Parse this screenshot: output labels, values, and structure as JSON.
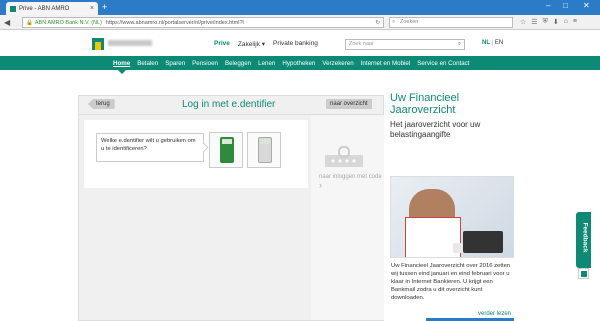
{
  "browser": {
    "tab_title": "Prive - ABN AMRO",
    "new_tab": "+",
    "window_controls": [
      "–",
      "□",
      "✕"
    ],
    "url_org": "ABN AMRO Bank N.V. (NL)",
    "url": "https://www.abnamro.nl/portalserver/nl/prive/index.html?l",
    "search_placeholder": "Zoeken"
  },
  "site": {
    "top_nav": [
      "Prive",
      "Zakelijk ▾",
      "Private banking"
    ],
    "search_placeholder": "Zoek naar",
    "lang_active": "NL",
    "lang_sep": " | ",
    "lang_other": "EN",
    "main_nav": [
      "Home",
      "Betalen",
      "Sparen",
      "Pensioen",
      "Beleggen",
      "Lenen",
      "Hypotheken",
      "Verzekeren",
      "Internet en Mobiel",
      "Service en Contact"
    ]
  },
  "login": {
    "back": "terug",
    "title": "Log in met e.dentifier",
    "overview": "naar overzicht",
    "hint": "Welke e.dentifier wilt u gebruiken om u te identificeren?",
    "qr_text": "naar inloggen met code",
    "qr_arrow": "›"
  },
  "promo": {
    "title": "Uw Financieel Jaaroverzicht",
    "subtitle": "Het jaaroverzicht voor uw belastingaangifte",
    "text": "Uw Financieel Jaaroverzicht over 2016 zetten wij tussen eind januari en eind februari voor u klaar in Internet Bankieren. U krijgt een Bankmail zodra u dit overzicht kunt downloaden.",
    "more": "verder lezen"
  },
  "feedback": {
    "label": "Feedback"
  }
}
